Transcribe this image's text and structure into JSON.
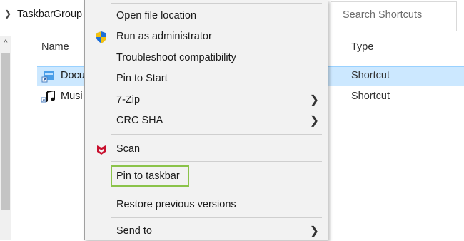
{
  "explorer": {
    "address_text": "TaskbarGroup",
    "search_placeholder": "Search Shortcuts",
    "columns": {
      "name": "Name",
      "type": "Type"
    },
    "rows": [
      {
        "name": "Docu",
        "type": "Shortcut",
        "selected": true
      },
      {
        "name": "Musi",
        "type": "Shortcut",
        "selected": false
      }
    ]
  },
  "context_menu": {
    "items": [
      {
        "label": "Open file location",
        "key": "open"
      },
      {
        "label": "Run as administrator",
        "key": "runas",
        "icon": "uac-shield-icon"
      },
      {
        "label": "Troubleshoot compatibility",
        "key": "troubleshoot"
      },
      {
        "label": "Pin to Start",
        "key": "pinstart"
      },
      {
        "label": "7-Zip",
        "key": "7zip",
        "submenu": true
      },
      {
        "label": "CRC SHA",
        "key": "crcsha",
        "submenu": true
      },
      {
        "label": "Scan",
        "key": "scan",
        "icon": "mcafee-icon"
      },
      {
        "label": "Pin to taskbar",
        "key": "pintaskbar",
        "highlighted": true
      },
      {
        "label": "Restore previous versions",
        "key": "restore"
      },
      {
        "label": "Send to",
        "key": "sendto",
        "submenu": true
      }
    ]
  },
  "colors": {
    "selection": "#cce8ff",
    "highlight_border": "#8bc34a",
    "mcafee_red": "#c8102e",
    "shield_blue": "#1e6fd9",
    "shield_yellow": "#f4c20d"
  }
}
